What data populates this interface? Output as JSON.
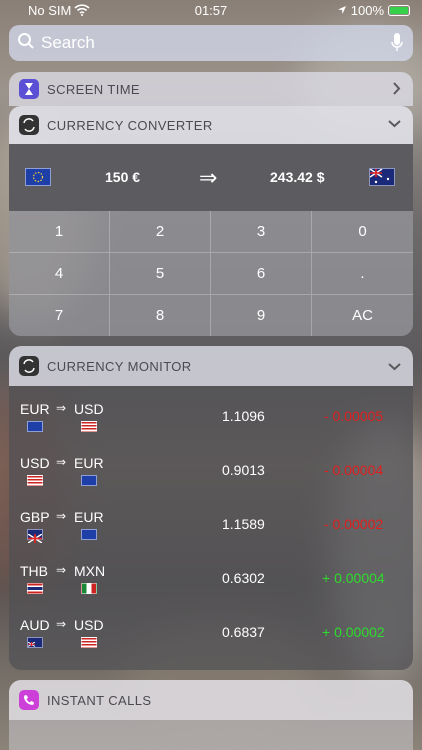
{
  "status": {
    "carrier": "No SIM",
    "time": "01:57",
    "battery": "100%"
  },
  "search": {
    "placeholder": "Search"
  },
  "screen_time": {
    "title": "SCREEN TIME"
  },
  "converter": {
    "title": "CURRENCY CONVERTER",
    "from_value": "150 €",
    "arrow": "⇒",
    "to_value": "243.42 $",
    "keys": [
      "1",
      "2",
      "3",
      "0",
      "4",
      "5",
      "6",
      ".",
      "7",
      "8",
      "9",
      "AC"
    ]
  },
  "monitor": {
    "title": "CURRENCY MONITOR",
    "rows": [
      {
        "from": "EUR",
        "to": "USD",
        "rate": "1.1096",
        "change": "- 0.00005",
        "trend": "down"
      },
      {
        "from": "USD",
        "to": "EUR",
        "rate": "0.9013",
        "change": "- 0.00004",
        "trend": "down"
      },
      {
        "from": "GBP",
        "to": "EUR",
        "rate": "1.1589",
        "change": "- 0.00002",
        "trend": "down"
      },
      {
        "from": "THB",
        "to": "MXN",
        "rate": "0.6302",
        "change": "+ 0.00004",
        "trend": "up"
      },
      {
        "from": "AUD",
        "to": "USD",
        "rate": "0.6837",
        "change": "+ 0.00002",
        "trend": "up"
      }
    ],
    "pair_arrow": "⇒"
  },
  "instant_calls": {
    "title": "INSTANT CALLS"
  },
  "colors": {
    "down": "#e01e1e",
    "up": "#2edb2e",
    "accent_purple": "#5b4fd6",
    "calls_pink": "#cc3fd8"
  }
}
